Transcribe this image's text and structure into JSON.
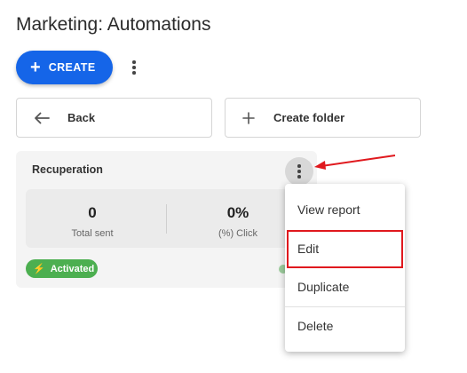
{
  "page": {
    "title": "Marketing: Automations"
  },
  "toolbar": {
    "create_label": "CREATE",
    "more_icon": "more-vertical-icon"
  },
  "nav": {
    "back_label": "Back",
    "create_folder_label": "Create folder"
  },
  "card": {
    "name": "Recuperation",
    "stats": [
      {
        "value": "0",
        "label": "Total sent"
      },
      {
        "value": "0%",
        "label": "(%) Click"
      }
    ],
    "status": "Activated",
    "status_color": "#4caf50"
  },
  "menu": {
    "items": [
      {
        "label": "View report"
      },
      {
        "label": "Edit",
        "highlighted": true
      },
      {
        "label": "Duplicate"
      },
      {
        "label": "Delete"
      }
    ]
  },
  "colors": {
    "accent": "#1565e8",
    "highlight": "#e0191e"
  }
}
